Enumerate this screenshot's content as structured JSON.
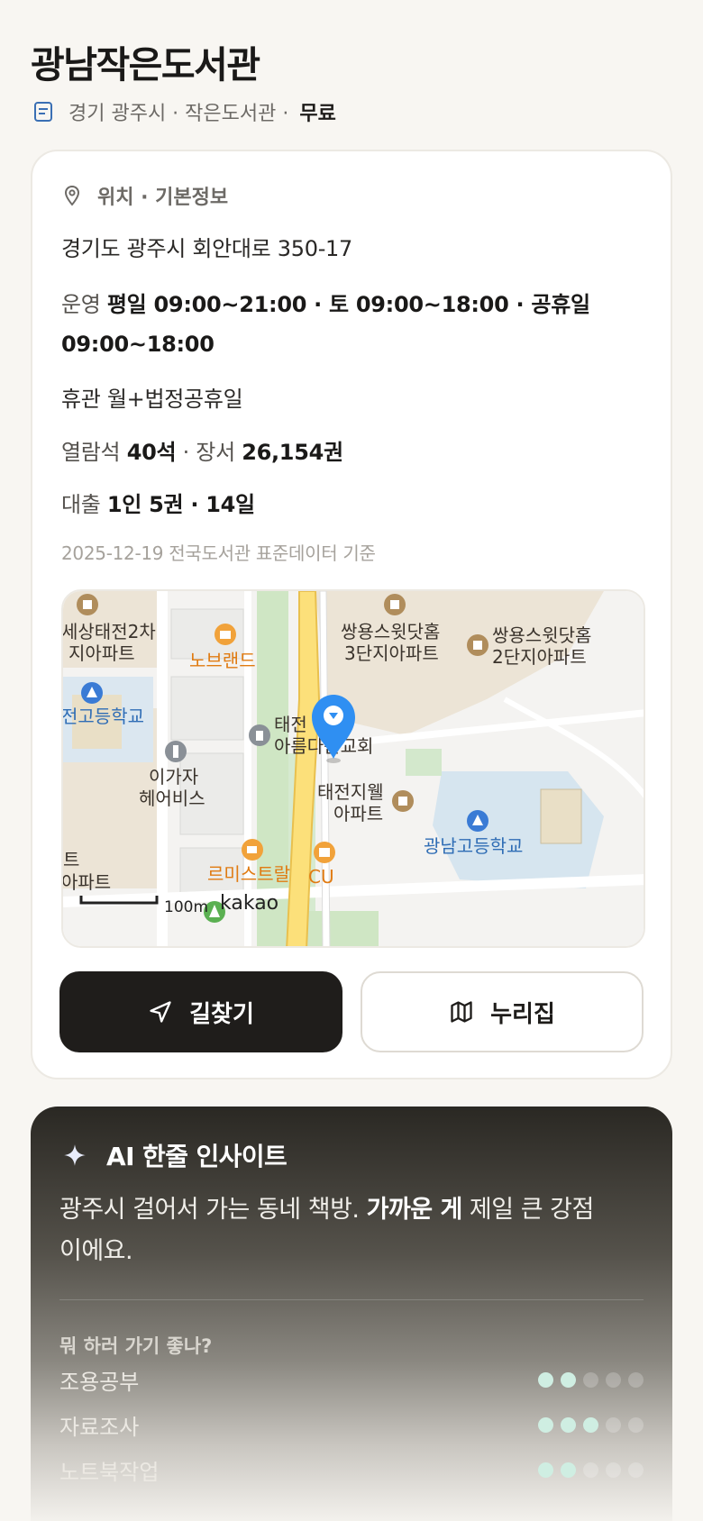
{
  "header": {
    "title": "광남작은도서관",
    "meta": "경기 광주시 · 작은도서관 ·",
    "fee": "무료"
  },
  "info": {
    "section_title": "위치 · 기본정보",
    "address": "경기도 광주시 회안대로 350-17",
    "hours_label": "운영",
    "hours_value": "평일 09:00~21:00 · 토 09:00~18:00 · 공휴일 09:00~18:00",
    "closed_text": "휴관 월+법정공휴일",
    "seats_label": "열람석",
    "seats_value": "40석",
    "books_label": "· 장서",
    "books_value": "26,154권",
    "loan_label": "대출",
    "loan_value": "1인 5권 · 14일",
    "source": "2025-12-19 전국도서관 표준데이터 기준"
  },
  "map": {
    "labels": {
      "apt_top_left": [
        "세상태전2차",
        "지아파트"
      ],
      "noblend": "노브랜드",
      "ssangyong3": [
        "쌍용스윗닷홈",
        "3단지아파트"
      ],
      "ssangyong2": [
        "쌍용스윗닷홈",
        "2단지아파트"
      ],
      "highschool_left": "전고등학교",
      "church": [
        "태전",
        "아름다운교회"
      ],
      "hair": [
        "이가자",
        "헤어비스"
      ],
      "taejeon_apt": [
        "태전지웰",
        "아파트"
      ],
      "gwangnam_hs": "광남고등학교",
      "apt_bottom_left": [
        "트",
        "아파트"
      ],
      "cafe": "르미스트랄",
      "cu": "CU",
      "scale": "100m",
      "brand": "kakao"
    }
  },
  "actions": {
    "directions": "길찾기",
    "nurizip": "누리집"
  },
  "ai": {
    "title": "AI 한줄 인사이트",
    "text_before": "광주시 걸어서 가는 동네 책방. ",
    "text_bold": "가까운 게",
    "text_after": " 제일 큰 강점이에요.",
    "question": "뭐 하러 가기 좋나?",
    "activities": [
      {
        "name": "조용공부",
        "score": 2,
        "max": 5
      },
      {
        "name": "자료조사",
        "score": 3,
        "max": 5
      },
      {
        "name": "노트북작업",
        "score": 2,
        "max": 5
      }
    ]
  },
  "colors": {
    "accent_dark": "#1f1d1b",
    "pin_blue": "#2f8ff2",
    "dot_on": "#cfeee2"
  }
}
